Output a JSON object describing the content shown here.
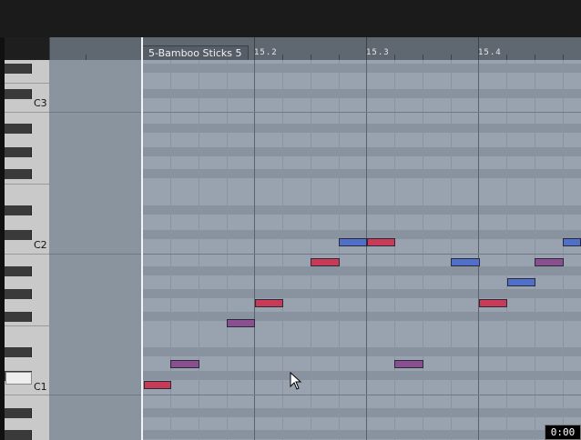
{
  "region": {
    "name": "5-Bamboo Sticks 5"
  },
  "ruler": {
    "markers": [
      "15.2",
      "15.3",
      "15.4"
    ]
  },
  "keyboard": {
    "octave_labels": [
      "C3",
      "C2",
      "C1"
    ]
  },
  "timer": {
    "value": "0:00"
  },
  "colors": {
    "note_red": "#c83a55",
    "note_blue": "#4f6fc8",
    "note_purple": "#8a4f8f",
    "grid_bg": "#98a3af",
    "playhead": "#f4f4f4"
  },
  "notes": [
    {
      "pitch": "C1",
      "bar": "15.1",
      "color": "note_red"
    },
    {
      "pitch": "D1",
      "bar": "15.1",
      "color": "note_purple"
    },
    {
      "pitch": "F1",
      "bar": "15.1",
      "color": "note_purple"
    },
    {
      "pitch": "G1",
      "bar": "15.2",
      "color": "note_red"
    },
    {
      "pitch": "B1",
      "bar": "15.2",
      "color": "note_red"
    },
    {
      "pitch": "C2",
      "bar": "15.2",
      "color": "note_blue"
    },
    {
      "pitch": "C2",
      "bar": "15.3",
      "color": "note_red"
    },
    {
      "pitch": "D1",
      "bar": "15.3",
      "color": "note_purple"
    },
    {
      "pitch": "B1",
      "bar": "15.3",
      "color": "note_blue"
    },
    {
      "pitch": "G1",
      "bar": "15.4",
      "color": "note_red"
    },
    {
      "pitch": "A1",
      "bar": "15.4",
      "color": "note_blue"
    },
    {
      "pitch": "B1",
      "bar": "15.4",
      "color": "note_purple"
    },
    {
      "pitch": "C2",
      "bar": "15.4",
      "color": "note_blue"
    }
  ]
}
